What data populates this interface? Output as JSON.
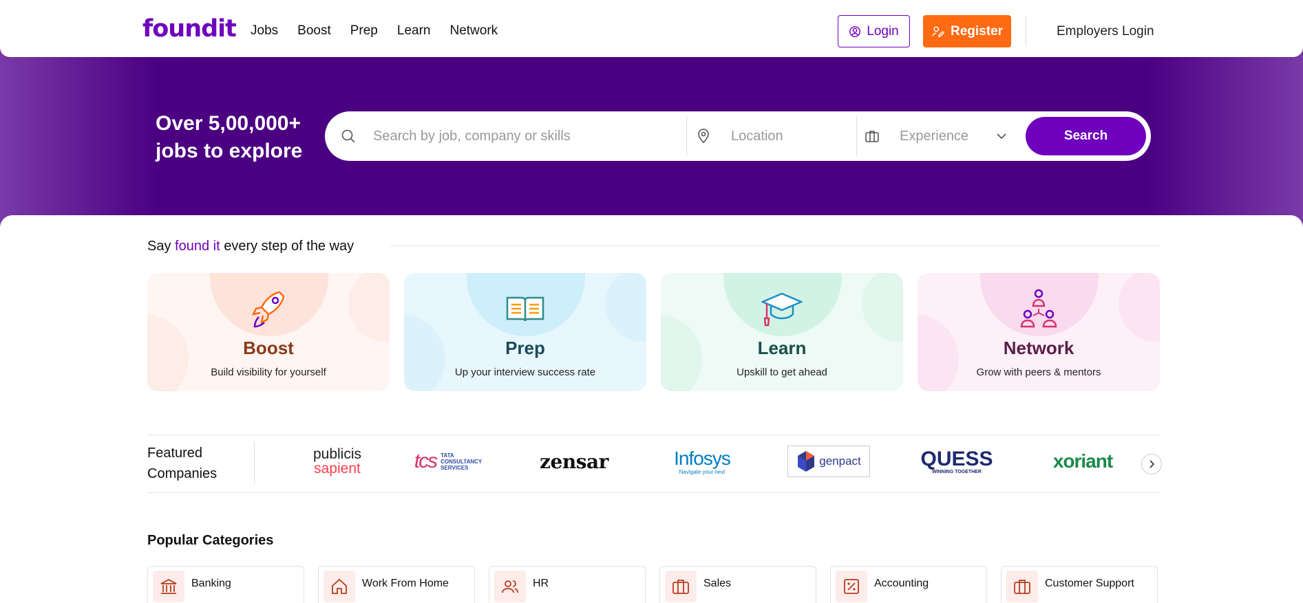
{
  "header": {
    "logo": "foundit",
    "nav": [
      "Jobs",
      "Boost",
      "Prep",
      "Learn",
      "Network"
    ],
    "login_label": "Login",
    "register_label": "Register",
    "employers_login_label": "Employers Login"
  },
  "hero": {
    "title_line1": "Over 5,00,000+",
    "title_line2": "jobs to explore",
    "search_placeholder": "Search by job, company or skills",
    "location_placeholder": "Location",
    "experience_placeholder": "Experience",
    "search_button": "Search"
  },
  "tagline": {
    "prefix": "Say ",
    "highlight": "found it",
    "suffix": " every step of the way"
  },
  "cards": [
    {
      "title": "Boost",
      "subtitle": "Build visibility for yourself",
      "title_color": "#8a3a1a",
      "bg": "#fff5f2",
      "circle": "#fde3da",
      "icon": "rocket-icon"
    },
    {
      "title": "Prep",
      "subtitle": "Up your interview success rate",
      "title_color": "#1d4a5c",
      "bg": "#e8f7fd",
      "circle": "#cdeefb",
      "icon": "book-icon"
    },
    {
      "title": "Learn",
      "subtitle": "Upskill to get ahead",
      "title_color": "#17504a",
      "bg": "#eefaf5",
      "circle": "#d3f2e6",
      "icon": "graduation-cap-icon"
    },
    {
      "title": "Network",
      "subtitle": "Grow with peers & mentors",
      "title_color": "#5a1d4a",
      "bg": "#fdf0f7",
      "circle": "#fadaee",
      "icon": "network-icon"
    }
  ],
  "featured": {
    "label_line1": "Featured",
    "label_line2": "Companies",
    "companies": [
      "publicis sapient",
      "tcs TATA CONSULTANCY SERVICES",
      "zensar",
      "Infosys",
      "genpact",
      "QUESS",
      "xoriant"
    ]
  },
  "popular": {
    "title": "Popular Categories",
    "categories": [
      {
        "label": "Banking",
        "icon": "bank-icon"
      },
      {
        "label": "Work From Home",
        "icon": "home-icon"
      },
      {
        "label": "HR",
        "icon": "users-icon"
      },
      {
        "label": "Sales",
        "icon": "briefcase-icon"
      },
      {
        "label": "Accounting",
        "icon": "percent-icon"
      },
      {
        "label": "Customer Support",
        "icon": "briefcase-icon"
      }
    ]
  },
  "colors": {
    "brand": "#6e00be",
    "register": "#ff6a13",
    "hero": "#4b0082"
  }
}
